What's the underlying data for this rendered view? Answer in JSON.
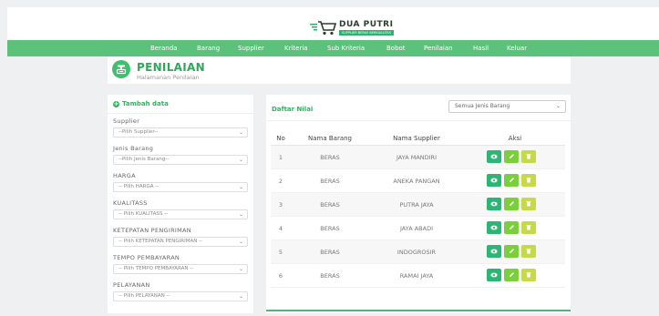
{
  "brand": {
    "name": "DUA PUTRI",
    "tagline": "SUPPLIER BERAS BERKUALITAS"
  },
  "nav": {
    "items": [
      {
        "label": "Beranda"
      },
      {
        "label": "Barang"
      },
      {
        "label": "Supplier"
      },
      {
        "label": "Kriteria"
      },
      {
        "label": "Sub Kriteria"
      },
      {
        "label": "Bobot"
      },
      {
        "label": "Penilaian"
      },
      {
        "label": "Hasil"
      },
      {
        "label": "Keluar"
      }
    ]
  },
  "page": {
    "title": "PENILAIAN",
    "subtitle": "Halamanan Penilaian"
  },
  "form": {
    "heading": "Tambah data",
    "fields": [
      {
        "label": "Supplier",
        "value": "--Pilih Supplier--"
      },
      {
        "label": "Jenis Barang",
        "value": "--Pilih Jenis Barang--"
      },
      {
        "label": "HARGA",
        "value": "-- Pilih HARGA --"
      },
      {
        "label": "KUALITASS",
        "value": "-- Pilih KUALITASS --"
      },
      {
        "label": "KETEPATAN PENGIRIMAN",
        "value": "-- Pilih KETEPATAN PENGIRIMAN --"
      },
      {
        "label": "TEMPO PEMBAYARAN",
        "value": "-- Pilih TEMPO PEMBAYARAN --"
      },
      {
        "label": "PELAYANAN",
        "value": "-- Pilih PELAYANAN --"
      }
    ]
  },
  "table": {
    "title": "Daftar Nilai",
    "filter_value": "Semua Jenis Barang",
    "columns": [
      "No",
      "Nama Barang",
      "Nama Supplier",
      "Aksi"
    ],
    "rows": [
      {
        "no": "1",
        "barang": "BERAS",
        "supplier": "JAYA MANDIRI"
      },
      {
        "no": "2",
        "barang": "BERAS",
        "supplier": "ANEKA PANGAN"
      },
      {
        "no": "3",
        "barang": "BERAS",
        "supplier": "PUTRA JAYA"
      },
      {
        "no": "4",
        "barang": "BERAS",
        "supplier": "JAYA ABADI"
      },
      {
        "no": "5",
        "barang": "BERAS",
        "supplier": "INDOGROSIR"
      },
      {
        "no": "6",
        "barang": "BERAS",
        "supplier": "RAMAI JAYA"
      }
    ]
  },
  "colors": {
    "nav_bg": "#5cc17a",
    "accent": "#37b064",
    "btn_view": "#2bb673",
    "btn_edit": "#7ccf3c",
    "btn_delete": "#c5d94a"
  },
  "icons": {
    "logo": "shopping-cart-icon",
    "page": "scale-icon",
    "add": "plus-circle-icon",
    "view": "eye-icon",
    "edit": "pencil-icon",
    "delete": "trash-icon",
    "dropdown": "chevron-down-icon"
  }
}
